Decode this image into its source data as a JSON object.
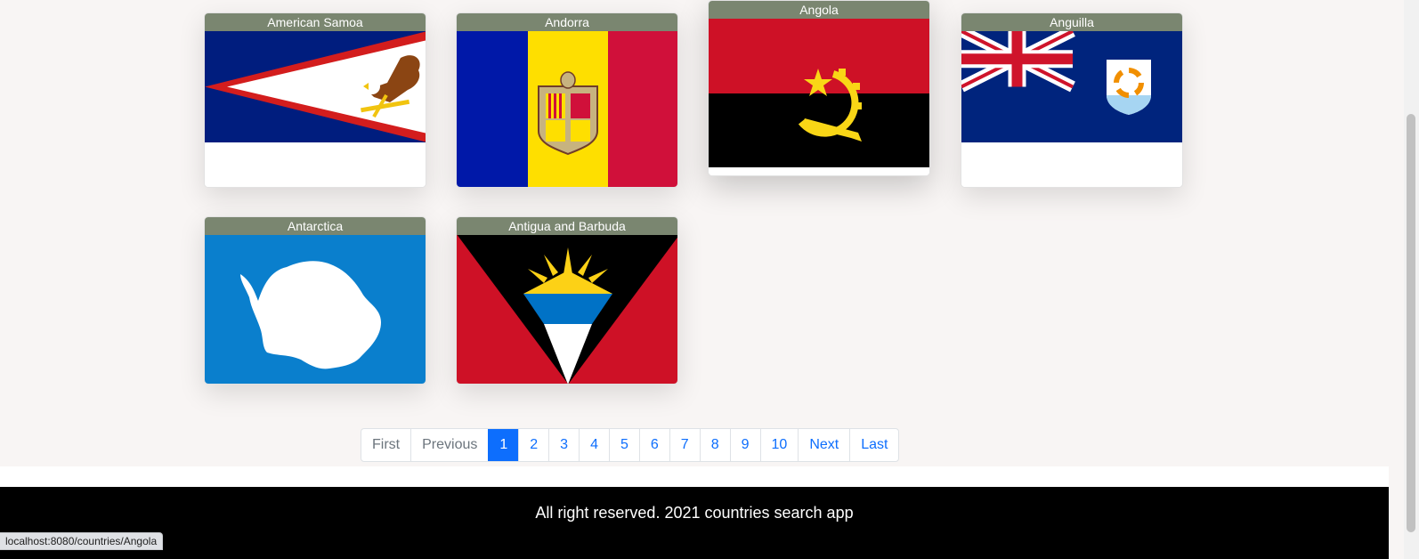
{
  "cards": [
    {
      "name": "American Samoa"
    },
    {
      "name": "Andorra"
    },
    {
      "name": "Angola"
    },
    {
      "name": "Anguilla"
    },
    {
      "name": "Antarctica"
    },
    {
      "name": "Antigua and Barbuda"
    }
  ],
  "pagination": {
    "first": "First",
    "previous": "Previous",
    "pages": [
      "1",
      "2",
      "3",
      "4",
      "5",
      "6",
      "7",
      "8",
      "9",
      "10"
    ],
    "active_page": "1",
    "next": "Next",
    "last": "Last"
  },
  "footer": {
    "text": "All right reserved. 2021 countries search app"
  },
  "status_bar": {
    "url": "localhost:8080/countries/Angola"
  },
  "colors": {
    "card_header": "#7a8670",
    "accent": "#0d6efd",
    "footer_bg": "#000000"
  }
}
